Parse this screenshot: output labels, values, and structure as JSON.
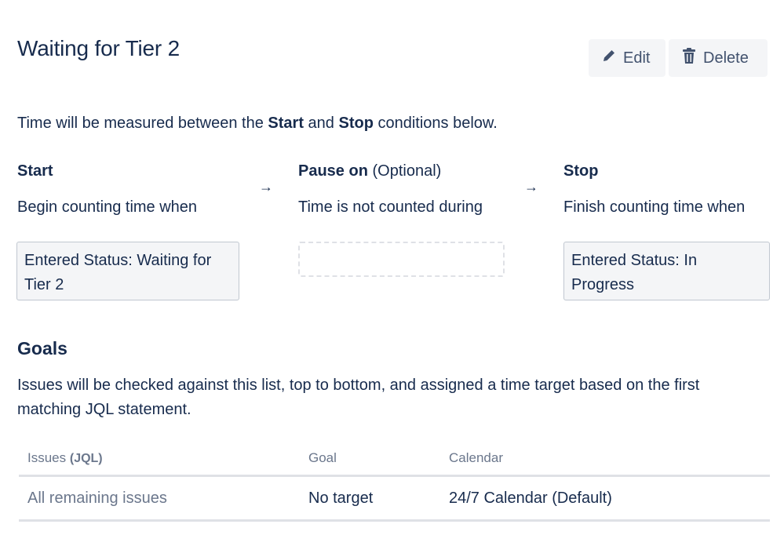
{
  "page": {
    "title": "Waiting for Tier 2"
  },
  "actions": {
    "edit_label": "Edit",
    "delete_label": "Delete"
  },
  "intro": {
    "prefix": "Time will be measured between the ",
    "start": "Start",
    "and": " and ",
    "stop": "Stop",
    "suffix": " conditions below."
  },
  "columns": {
    "start": {
      "heading": "Start",
      "description": "Begin counting time when",
      "condition_line1": "Entered Status: Waiting for",
      "condition_line2": "Tier 2"
    },
    "pause": {
      "heading": "Pause on",
      "optional": " (Optional)",
      "description": "Time is not counted during"
    },
    "stop": {
      "heading": "Stop",
      "description": "Finish counting time when",
      "condition_line1": "Entered Status: In",
      "condition_line2": "Progress"
    },
    "arrow": "→"
  },
  "goals": {
    "heading": "Goals",
    "description": "Issues will be checked against this list, top to bottom, and assigned a time target based on the first matching JQL statement.",
    "table": {
      "headers": {
        "issues": "Issues ",
        "issues_jql": "(JQL)",
        "goal": "Goal",
        "calendar": "Calendar"
      },
      "rows": [
        {
          "issues": "All remaining issues",
          "goal": "No target",
          "calendar": "24/7 Calendar (Default)"
        }
      ]
    }
  },
  "icons": {
    "edit": "pencil-icon",
    "delete": "trash-icon"
  },
  "colors": {
    "text": "#172b4d",
    "muted": "#6b778c",
    "button_bg": "#f4f5f7",
    "border": "#c1c7d0"
  }
}
